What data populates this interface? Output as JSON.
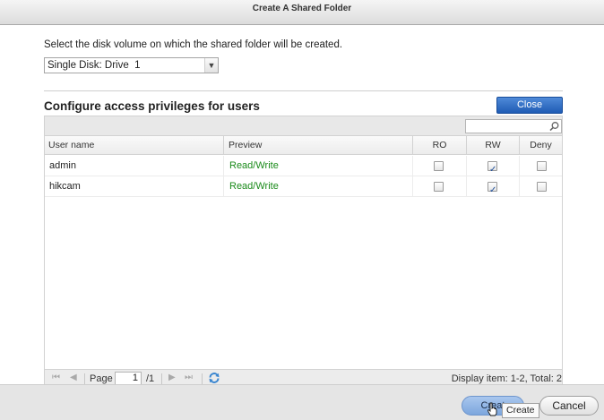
{
  "dialog": {
    "title": "Create A Shared Folder"
  },
  "disk": {
    "label": "Select the disk volume on which the shared folder will be created.",
    "selected": "Single Disk: Drive  1"
  },
  "access": {
    "title": "Configure access privileges for users",
    "close_label": "Close"
  },
  "grid": {
    "search_placeholder": "",
    "columns": [
      "User name",
      "Preview",
      "RO",
      "RW",
      "Deny"
    ],
    "rows": [
      {
        "user": "admin",
        "preview": "Read/Write",
        "ro": false,
        "rw": true,
        "deny": false
      },
      {
        "user": "hikcam",
        "preview": "Read/Write",
        "ro": false,
        "rw": true,
        "deny": false
      }
    ],
    "pager": {
      "page_label": "Page",
      "page_value": "1",
      "total_pages": "/1",
      "display_info": "Display item: 1-2, Total: 2"
    }
  },
  "footer": {
    "create_label": "Creat",
    "cancel_label": "Cancel",
    "tooltip": "Create"
  },
  "colors": {
    "accent": "#2a66c0",
    "preview_text": "#1a8a1a"
  }
}
